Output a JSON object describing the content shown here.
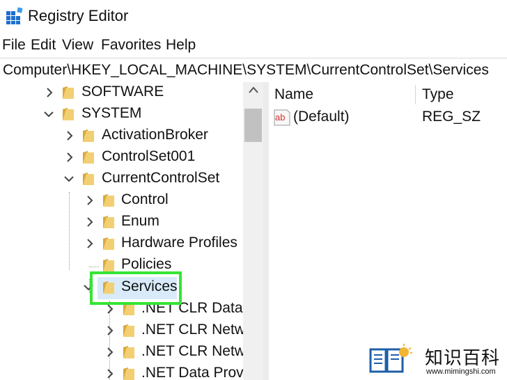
{
  "window": {
    "title": "Registry Editor",
    "icon": "registry-editor-icon"
  },
  "menu": [
    "File",
    "Edit",
    "View",
    "Favorites",
    "Help"
  ],
  "address": "Computer\\HKEY_LOCAL_MACHINE\\SYSTEM\\CurrentControlSet\\Services",
  "tree": [
    {
      "label": "SOFTWARE",
      "state": "collapsed"
    },
    {
      "label": "SYSTEM",
      "state": "expanded"
    },
    {
      "label": "ActivationBroker",
      "state": "collapsed"
    },
    {
      "label": "ControlSet001",
      "state": "collapsed"
    },
    {
      "label": "CurrentControlSet",
      "state": "expanded"
    },
    {
      "label": "Control",
      "state": "collapsed"
    },
    {
      "label": "Enum",
      "state": "collapsed"
    },
    {
      "label": "Hardware Profiles",
      "state": "collapsed"
    },
    {
      "label": "Policies",
      "state": "leaf"
    },
    {
      "label": "Services",
      "state": "expanded",
      "selected": true
    },
    {
      "label": ".NET CLR Data",
      "state": "collapsed"
    },
    {
      "label": ".NET CLR Netwo",
      "state": "collapsed"
    },
    {
      "label": ".NET CLR Netwo",
      "state": "collapsed"
    },
    {
      "label": ".NET Data Provi",
      "state": "collapsed"
    }
  ],
  "values": {
    "columns": [
      "Name",
      "Type"
    ],
    "rows": [
      {
        "name": "(Default)",
        "type": "REG_SZ",
        "icon": "string-value-icon"
      }
    ]
  },
  "colors": {
    "highlight": "#35e535",
    "folder": "#e8c15a",
    "selection": "#d9ebfa"
  },
  "watermark": {
    "text": "知识百科",
    "url": "www.mimingshi.com"
  }
}
